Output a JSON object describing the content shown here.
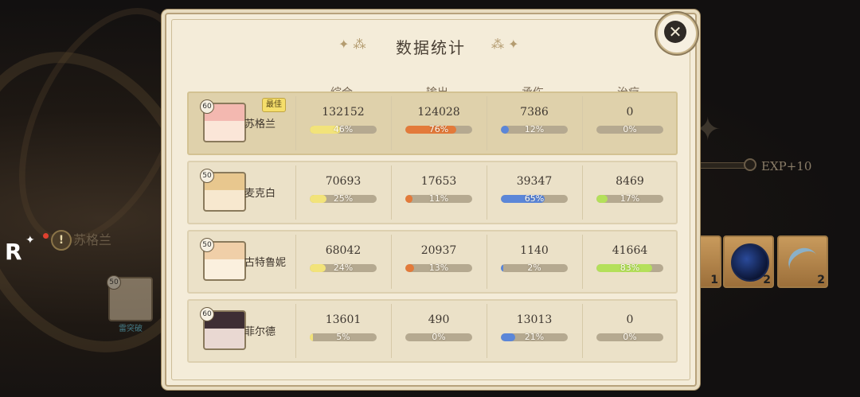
{
  "panel": {
    "title": "数据统计",
    "close_icon": "close-shuriken-icon",
    "columns": [
      "综合",
      "输出",
      "承伤",
      "治疗"
    ],
    "best_label": "最佳",
    "bar_colors": {
      "total": "#f2e37a",
      "damage": "#e37a3a",
      "taken": "#5b86d8",
      "healing": "#b4e05a"
    },
    "rows": [
      {
        "level": "60",
        "name": "苏格兰",
        "best": true,
        "portrait_colors": [
          "#f3b8b0",
          "#fbe6d8"
        ],
        "total": {
          "value": "132152",
          "pct": "46%",
          "frac": 0.46
        },
        "damage": {
          "value": "124028",
          "pct": "76%",
          "frac": 0.76
        },
        "taken": {
          "value": "7386",
          "pct": "12%",
          "frac": 0.12
        },
        "healing": {
          "value": "0",
          "pct": "0%",
          "frac": 0
        }
      },
      {
        "level": "50",
        "name": "麦克白",
        "best": false,
        "portrait_colors": [
          "#e8c78e",
          "#f7e8cf"
        ],
        "total": {
          "value": "70693",
          "pct": "25%",
          "frac": 0.25
        },
        "damage": {
          "value": "17653",
          "pct": "11%",
          "frac": 0.11
        },
        "taken": {
          "value": "39347",
          "pct": "65%",
          "frac": 0.65
        },
        "healing": {
          "value": "8469",
          "pct": "17%",
          "frac": 0.17
        }
      },
      {
        "level": "50",
        "name": "古特鲁妮",
        "best": false,
        "portrait_colors": [
          "#f0cfa8",
          "#fbf0de"
        ],
        "total": {
          "value": "68042",
          "pct": "24%",
          "frac": 0.24
        },
        "damage": {
          "value": "20937",
          "pct": "13%",
          "frac": 0.13
        },
        "taken": {
          "value": "1140",
          "pct": "2%",
          "frac": 0.02
        },
        "healing": {
          "value": "41664",
          "pct": "83%",
          "frac": 0.83
        }
      },
      {
        "level": "60",
        "name": "菲尔德",
        "best": false,
        "portrait_colors": [
          "#3e2e34",
          "#e9d8d2"
        ],
        "total": {
          "value": "13601",
          "pct": "5%",
          "frac": 0.05
        },
        "damage": {
          "value": "490",
          "pct": "0%",
          "frac": 0
        },
        "taken": {
          "value": "13013",
          "pct": "21%",
          "frac": 0.21
        },
        "healing": {
          "value": "0",
          "pct": "0%",
          "frac": 0
        }
      }
    ]
  },
  "background": {
    "player_name": "苏格兰",
    "exp_text": "EXP+10",
    "char_level": "50",
    "char_label": "雷突破",
    "items": [
      {
        "icon": "red-feather-icon",
        "count": "1"
      },
      {
        "icon": "blue-orb-icon",
        "count": "2"
      },
      {
        "icon": "blade-icon",
        "count": "2"
      }
    ]
  }
}
